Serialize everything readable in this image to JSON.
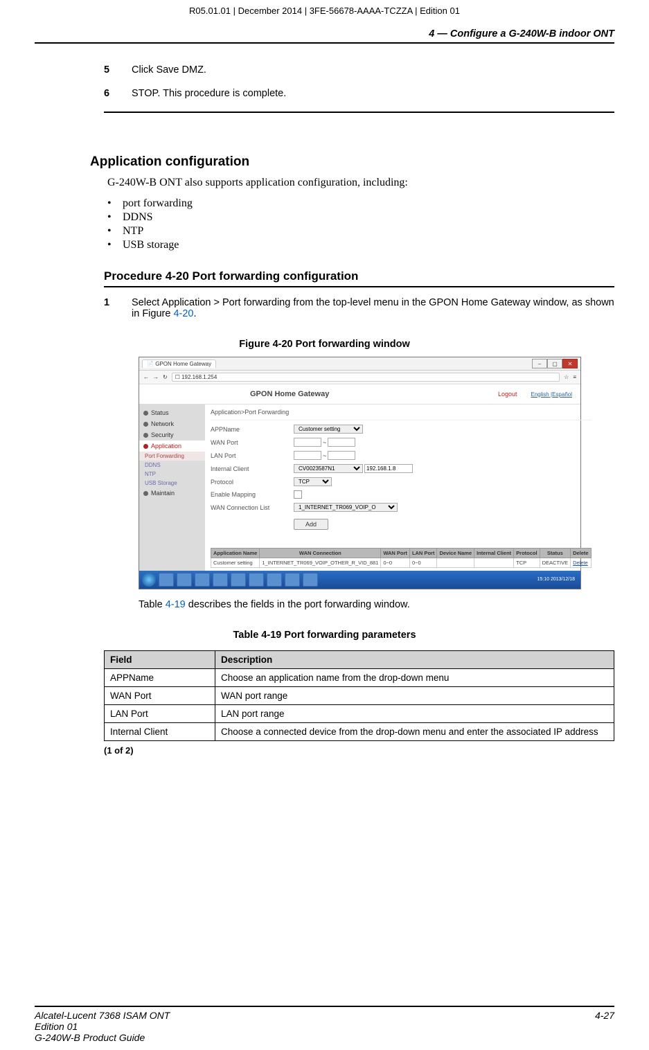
{
  "header_meta": "R05.01.01 | December 2014 | 3FE-56678-AAAA-TCZZA | Edition 01",
  "chapter_title": "4 —  Configure a G-240W-B indoor ONT",
  "steps_prev": [
    {
      "num": "5",
      "text": "Click Save DMZ."
    },
    {
      "num": "6",
      "text": "STOP. This procedure is complete."
    }
  ],
  "section": {
    "title": "Application configuration",
    "intro": "G-240W-B ONT also supports application configuration, including:",
    "features": [
      "port forwarding",
      "DDNS",
      "NTP",
      "USB storage"
    ]
  },
  "procedure": {
    "title": "Procedure 4-20  Port forwarding configuration",
    "step1_num": "1",
    "step1_pre": "Select Application > Port forwarding from the top-level menu in the GPON Home Gateway window, as shown in Figure ",
    "step1_link": "4-20",
    "step1_post": "."
  },
  "figure": {
    "caption": "Figure 4-20  Port forwarding window",
    "tab_title": "GPON Home Gateway",
    "url": "192.168.1.254",
    "app_title": "GPON Home Gateway",
    "logout": "Logout",
    "lang_en": "English",
    "lang_es": "Español",
    "crumb": "Application>Port Forwarding",
    "sidebar_top": [
      "Status",
      "Network",
      "Security",
      "Application"
    ],
    "sidebar_sub": [
      "Port Forwarding",
      "DDNS",
      "NTP",
      "USB Storage"
    ],
    "sidebar_after": [
      "Maintain"
    ],
    "form": {
      "appname_lbl": "APPName",
      "appname_val": "Customer setting",
      "wanport_lbl": "WAN Port",
      "sep": "~",
      "lanport_lbl": "LAN Port",
      "iclient_lbl": "Internal Client",
      "iclient_sel": "CV0023587N1",
      "iclient_ip": "192.168.1.8",
      "proto_lbl": "Protocol",
      "proto_val": "TCP",
      "enable_lbl": "Enable Mapping",
      "wanconn_lbl": "WAN Connection List",
      "wanconn_val": "1_INTERNET_TR069_VOIP_O",
      "add_btn": "Add"
    },
    "dtable": {
      "headers": [
        "Application Name",
        "WAN Connection",
        "WAN Port",
        "LAN Port",
        "Device Name",
        "Internal Client",
        "Protocol",
        "Status",
        "Delete"
      ],
      "row": [
        "Customer setting",
        "1_INTERNET_TR069_VOIP_OTHER_R_VID_881",
        "0~0",
        "0~0",
        "",
        "",
        "TCP",
        "DEACTIVE",
        "Delete"
      ]
    },
    "clock": "15:10\n2013/12/18"
  },
  "after_fig": {
    "pre": "Table ",
    "link": "4-19",
    "post": " describes the fields in the port forwarding window."
  },
  "table": {
    "caption": "Table 4-19 Port forwarding parameters",
    "head_field": "Field",
    "head_desc": "Description",
    "rows": [
      {
        "f": "APPName",
        "d": "Choose an application name from the drop-down menu"
      },
      {
        "f": "WAN Port",
        "d": "WAN port range"
      },
      {
        "f": "LAN Port",
        "d": "LAN port range"
      },
      {
        "f": "Internal Client",
        "d": "Choose a connected device from the drop-down menu and enter the associated IP address"
      }
    ],
    "foot": "(1 of 2)"
  },
  "footer": {
    "l1": "Alcatel-Lucent 7368 ISAM ONT",
    "l2": "Edition 01",
    "l3": "G-240W-B Product Guide",
    "page": "4-27"
  }
}
